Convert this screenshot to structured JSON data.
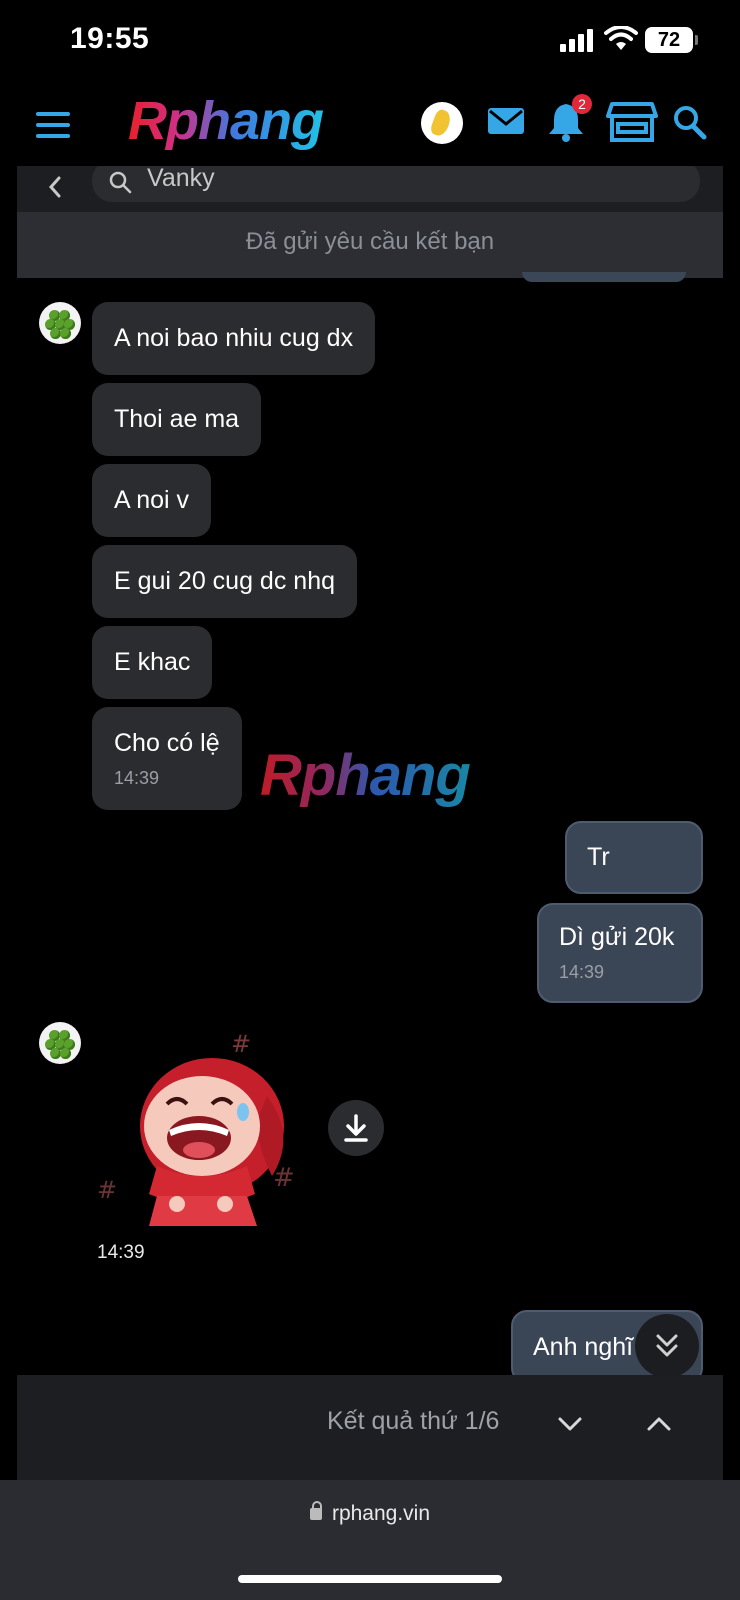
{
  "status_bar": {
    "time": "19:55",
    "battery": "72"
  },
  "header": {
    "logo": "Rphang",
    "notification_count": "2"
  },
  "search": {
    "query": "Vanky"
  },
  "banner": {
    "text": "Đã gửi yêu cầu kết bạn"
  },
  "messages_in_1": [
    {
      "text": "A noi bao nhiu cug dx"
    },
    {
      "text": "Thoi ae ma"
    },
    {
      "text": "A noi v"
    },
    {
      "text": "E gui 20 cug dc nhq"
    },
    {
      "text": "E khac"
    },
    {
      "text": "Cho có lệ",
      "time": "14:39"
    }
  ],
  "messages_out_1": [
    {
      "text": "Tr"
    },
    {
      "text": "Dì gửi 20k",
      "time": "14:39"
    }
  ],
  "sticker": {
    "time": "14:39"
  },
  "messages_out_2": [
    {
      "text": "Anh nghĩ"
    }
  ],
  "watermark": "Rphang",
  "search_results": {
    "text": "Kết quả thứ 1/6"
  },
  "browser": {
    "url": "rphang.vin"
  },
  "colors": {
    "accent": "#35a7e6",
    "incoming_bubble": "#2b2c2f",
    "outgoing_bubble": "#3a4555",
    "badge": "#e0283a"
  }
}
